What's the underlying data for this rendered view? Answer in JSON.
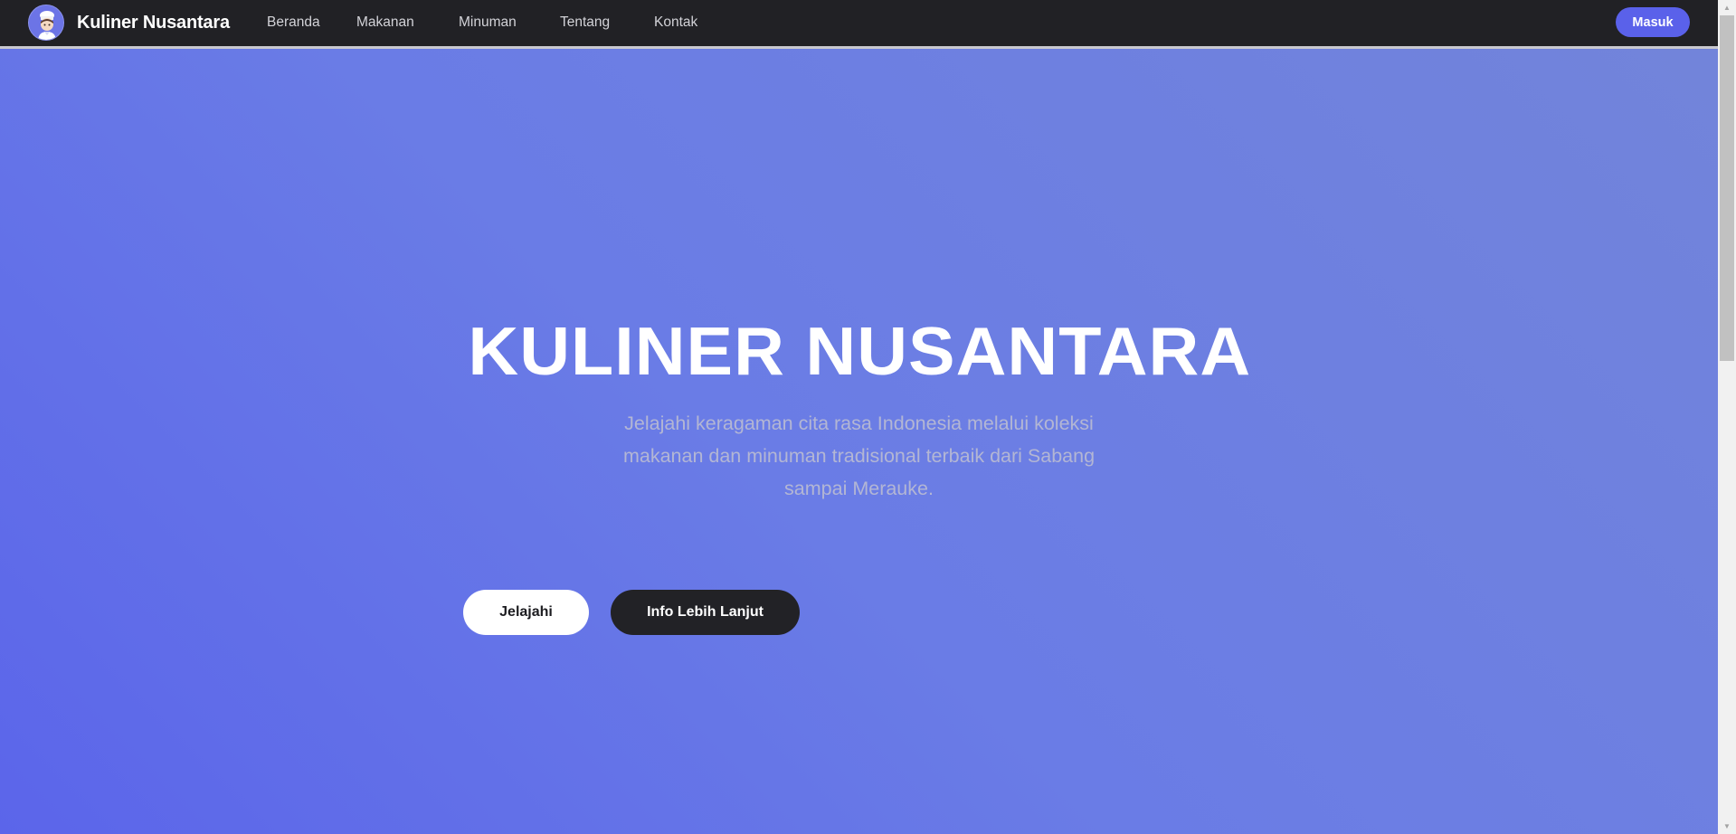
{
  "navbar": {
    "brand": "Kuliner Nusantara",
    "logo_icon": "chef-avatar-icon",
    "links": [
      "Beranda",
      "Makanan",
      "Minuman",
      "Tentang",
      "Kontak"
    ],
    "login_label": "Masuk"
  },
  "hero": {
    "title": "KULINER NUSANTARA",
    "subtitle": "Jelajahi keragaman cita rasa Indonesia melalui koleksi makanan dan minuman tradisional terbaik dari Sabang sampai Merauke.",
    "primary_button": "Jelajahi",
    "secondary_button": "Info Lebih Lanjut"
  },
  "colors": {
    "navbar_bg": "#212125",
    "accent": "#5a61ea",
    "hero_gradient_start": "#5b65ea",
    "hero_gradient_end": "#7284da",
    "subtitle_text": "#b3b6d4",
    "dark_button": "#222226"
  }
}
